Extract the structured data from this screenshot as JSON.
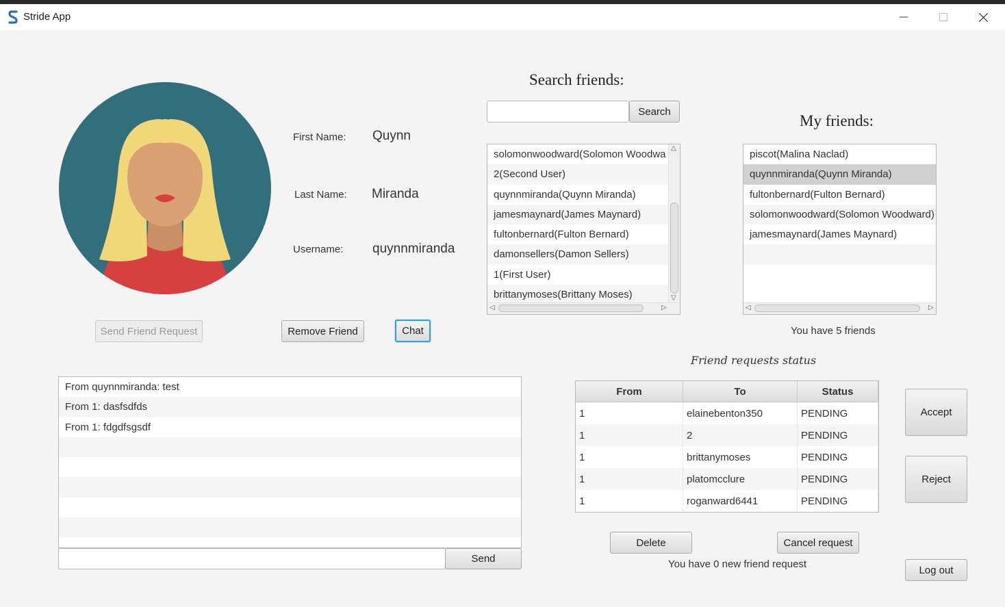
{
  "window": {
    "title": "Stride App"
  },
  "profile": {
    "first_name_label": "First Name:",
    "first_name": "Quynn",
    "last_name_label": "Last Name:",
    "last_name": "Miranda",
    "username_label": "Username:",
    "username": "quynnmiranda"
  },
  "actions": {
    "send_friend_request": "Send Friend Request",
    "remove_friend": "Remove Friend",
    "chat": "Chat"
  },
  "search": {
    "heading": "Search friends:",
    "input_value": "",
    "button": "Search",
    "results": [
      "solomonwoodward(Solomon Woodwa",
      "2(Second User)",
      "quynnmiranda(Quynn Miranda)",
      "jamesmaynard(James Maynard)",
      "fultonbernard(Fulton Bernard)",
      "damonsellers(Damon Sellers)",
      "1(First User)",
      "brittanymoses(Brittany Moses)"
    ]
  },
  "friends": {
    "heading": "My friends:",
    "items": [
      "piscot(Malina Naclad)",
      "quynnmiranda(Quynn Miranda)",
      "fultonbernard(Fulton Bernard)",
      "solomonwoodward(Solomon Woodward)",
      "jamesmaynard(James Maynard)"
    ],
    "selected_index": 1,
    "count_text": "You have 5 friends"
  },
  "chat": {
    "messages": [
      "From quynnmiranda: test",
      "From 1: dasfsdfds",
      "From 1: fdgdfsgsdf"
    ],
    "input_value": "",
    "send_button": "Send"
  },
  "requests": {
    "heading": "Friend requests status",
    "columns": [
      "From",
      "To",
      "Status"
    ],
    "rows": [
      [
        "1",
        "elainebenton350",
        "PENDING"
      ],
      [
        "1",
        "2",
        "PENDING"
      ],
      [
        "1",
        "brittanymoses",
        "PENDING"
      ],
      [
        "1",
        "platomcclure",
        "PENDING"
      ],
      [
        "1",
        "roganward6441",
        "PENDING"
      ]
    ],
    "accept_button": "Accept",
    "reject_button": "Reject",
    "delete_button": "Delete",
    "cancel_button": "Cancel request",
    "new_requests_text": "You have 0 new friend request",
    "logout_button": "Log out"
  },
  "colors": {
    "avatar_bg": "#336e7d",
    "hair": "#f0d778",
    "skin": "#d9a074",
    "shirt": "#d6403e",
    "focus": "#3aa0d4",
    "selection": "#d0d0d0"
  }
}
